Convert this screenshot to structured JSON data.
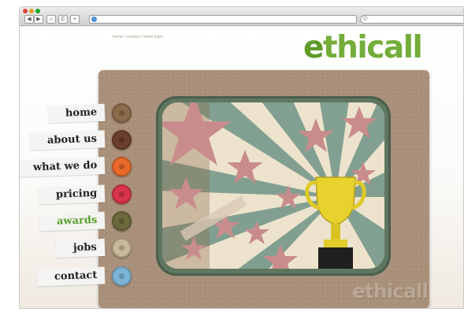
{
  "browser": {
    "back_label": "◀",
    "forward_label": "▶",
    "home_label": "⌂",
    "reload_label": "C",
    "add_label": "+",
    "search_placeholder": "Q-"
  },
  "page": {
    "top_links": "home / contact / client login",
    "logo_text": "ethicall",
    "watermark_text": "ethicall"
  },
  "nav": [
    {
      "label": "home",
      "button_color": "#8a6b4a",
      "active": false
    },
    {
      "label": "about us",
      "button_color": "#6b3f2e",
      "active": false
    },
    {
      "label": "what we do",
      "button_color": "#e8692a",
      "active": false
    },
    {
      "label": "pricing",
      "button_color": "#d8334c",
      "active": false
    },
    {
      "label": "awards",
      "button_color": "#6c6a3c",
      "active": true
    },
    {
      "label": "jobs",
      "button_color": "#c9b79a",
      "active": false
    },
    {
      "label": "contact",
      "button_color": "#7bb4d6",
      "active": false
    }
  ],
  "colors": {
    "brand_green": "#74ad3a",
    "active_nav": "#5aa02c",
    "board": "#a9907a",
    "tv_frame": "#5f7760"
  },
  "icons": {
    "tv_scene": "trophy-with-stars-icon"
  }
}
